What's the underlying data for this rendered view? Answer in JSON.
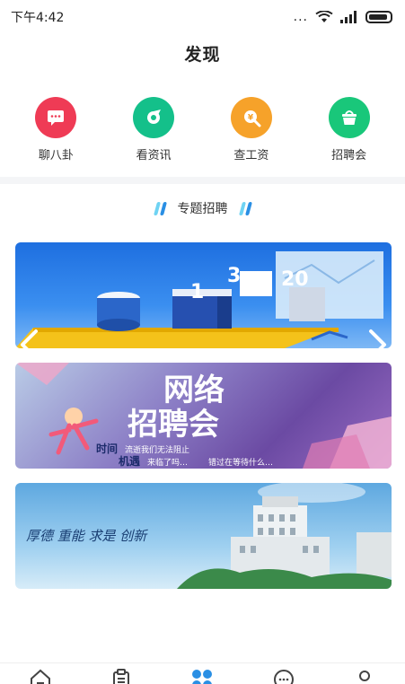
{
  "status_bar": {
    "time": "下午4:42",
    "dots": "..."
  },
  "header": {
    "title": "发现"
  },
  "quick_menu": [
    {
      "label": "聊八卦",
      "icon": "chat-icon",
      "color": "#ef3b55"
    },
    {
      "label": "看资讯",
      "icon": "news-icon",
      "color": "#14c08a"
    },
    {
      "label": "查工资",
      "icon": "salary-icon",
      "color": "#f6a22a"
    },
    {
      "label": "招聘会",
      "icon": "basket-icon",
      "color": "#19c77a"
    }
  ],
  "section": {
    "title": "专题招聘",
    "accent_light": "#6fd3f3",
    "accent_dark": "#2a8fe4"
  },
  "banners": [
    {
      "name": "data-illustration-banner",
      "numbers": [
        "1",
        "3",
        "20"
      ]
    },
    {
      "name": "network-job-fair-banner",
      "title_line1": "网络",
      "title_line2": "招聘会",
      "subtitle_a": "时间",
      "subtitle_b": "流逝我们无法阻止",
      "subtitle_c": "机遇",
      "subtitle_d": "来临了吗…",
      "subtitle_e": "错过在等待什么…"
    },
    {
      "name": "campus-building-banner",
      "motto": "厚德 重能 求是 创新"
    }
  ],
  "bottom_nav": [
    {
      "icon": "home-icon",
      "active": false
    },
    {
      "icon": "clipboard-icon",
      "active": false
    },
    {
      "icon": "discover-icon",
      "active": true
    },
    {
      "icon": "message-icon",
      "active": false
    },
    {
      "icon": "profile-icon",
      "active": false
    }
  ],
  "colors": {
    "active": "#2a8fe4",
    "inactive": "#444444"
  }
}
